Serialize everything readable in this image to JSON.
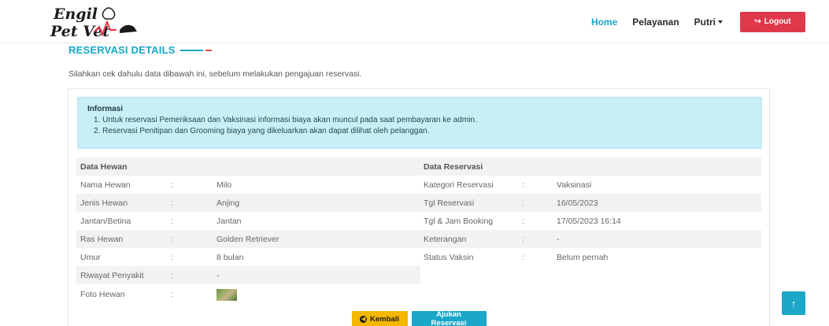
{
  "brand": {
    "line1": "Engil",
    "line2": "Pet Vet"
  },
  "nav": {
    "home": "Home",
    "services": "Pelayanan",
    "user": "Putri",
    "logout": "Logout",
    "logout_icon": "sign-out-icon"
  },
  "section": {
    "title": "RESERVASI DETAILS",
    "subtitle": "Silahkan cek dahulu data dibawah ini, sebelum melakukan pengajuan reservasi."
  },
  "info": {
    "title": "Informasi",
    "items": [
      "1. Untuk reservasi Pemeriksaan dan Vaksinasi informasi biaya akan muncul pada saat pembayaran ke admin.",
      "2. Reservasi Penitipan dan Grooming biaya yang dikeluarkan akan dapat dilihat oleh pelanggan."
    ]
  },
  "pet": {
    "header": "Data Hewan",
    "separator": ":",
    "rows": [
      {
        "label": "Nama Hewan",
        "value": "Milo"
      },
      {
        "label": "Jenis Hewan",
        "value": "Anjing"
      },
      {
        "label": "Jantan/Betina",
        "value": "Jantan"
      },
      {
        "label": "Ras Hewan",
        "value": "Golden Retriever"
      },
      {
        "label": "Umur",
        "value": "8 bulan"
      },
      {
        "label": "Riwayat Penyakit",
        "value": "-"
      },
      {
        "label": "Foto Hewan",
        "value": ""
      }
    ]
  },
  "reservation": {
    "header": "Data Reservasi",
    "rows": [
      {
        "label": "Kategori Reservasi",
        "value": "Vaksinasi"
      },
      {
        "label": "Tgl Reservasi",
        "value": "16/05/2023"
      },
      {
        "label": "Tgl & Jam Booking",
        "value": "17/05/2023 16:14"
      },
      {
        "label": "Keterangan",
        "value": "-"
      },
      {
        "label": "Status Vaksin",
        "value": "Belum pernah"
      }
    ]
  },
  "buttons": {
    "back": "Kembali",
    "submit": "Ajukan Reservasi"
  },
  "colors": {
    "accent": "#1aa7c8",
    "danger": "#e0384b",
    "warning": "#f5b800",
    "info_bg": "#c8eef6"
  }
}
